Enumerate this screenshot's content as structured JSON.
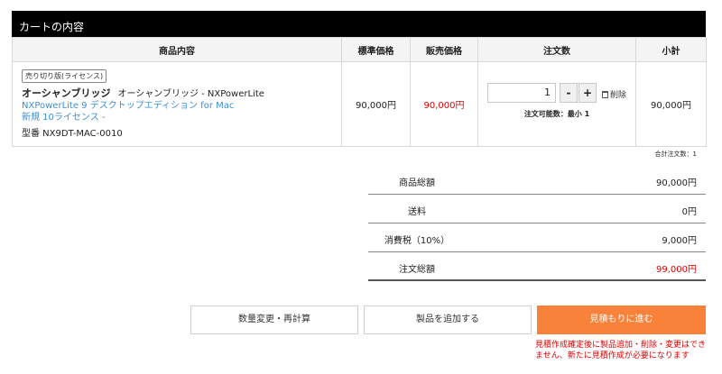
{
  "cart": {
    "title": "カートの内容",
    "columns": {
      "product": "商品内容",
      "standard_price": "標準価格",
      "sale_price": "販売価格",
      "quantity": "注文数",
      "subtotal": "小計"
    },
    "item": {
      "badge": "売り切り版(ライセンス)",
      "brand": "オーシャンブリッジ",
      "maker_product": "オーシャンブリッジ - NXPowerLite",
      "link_line1": "NXPowerLite 9 デスクトップエディション for Mac",
      "link_line2": "新規 10ライセンス -",
      "model": "型番  NX9DT-MAC-0010",
      "standard_price": "90,000円",
      "sale_price": "90,000円",
      "quantity": "1",
      "minus": "-",
      "plus": "+",
      "delete": "削除",
      "qty_note": "注文可能数：最小 1",
      "subtotal": "90,000円"
    },
    "total_quantity": "合計注文数：1"
  },
  "summary": [
    {
      "label": "商品総額",
      "value": "90,000円"
    },
    {
      "label": "送料",
      "value": "0円"
    },
    {
      "label": "消費税（10%）",
      "value": "9,000円"
    },
    {
      "label": "注文総額",
      "value": "99,000円"
    }
  ],
  "buttons": {
    "recalc": "数量変更・再計算",
    "add": "製品を追加する",
    "quote": "見積もりに進む"
  },
  "warning": "見積作成確定後に製品追加・削除・変更はできません、新たに見積作成が必要になります",
  "colors": {
    "header_bg": "#000000",
    "price_red": "#e00000",
    "link_blue": "#3d8fd6",
    "primary_orange": "#f8823a"
  }
}
